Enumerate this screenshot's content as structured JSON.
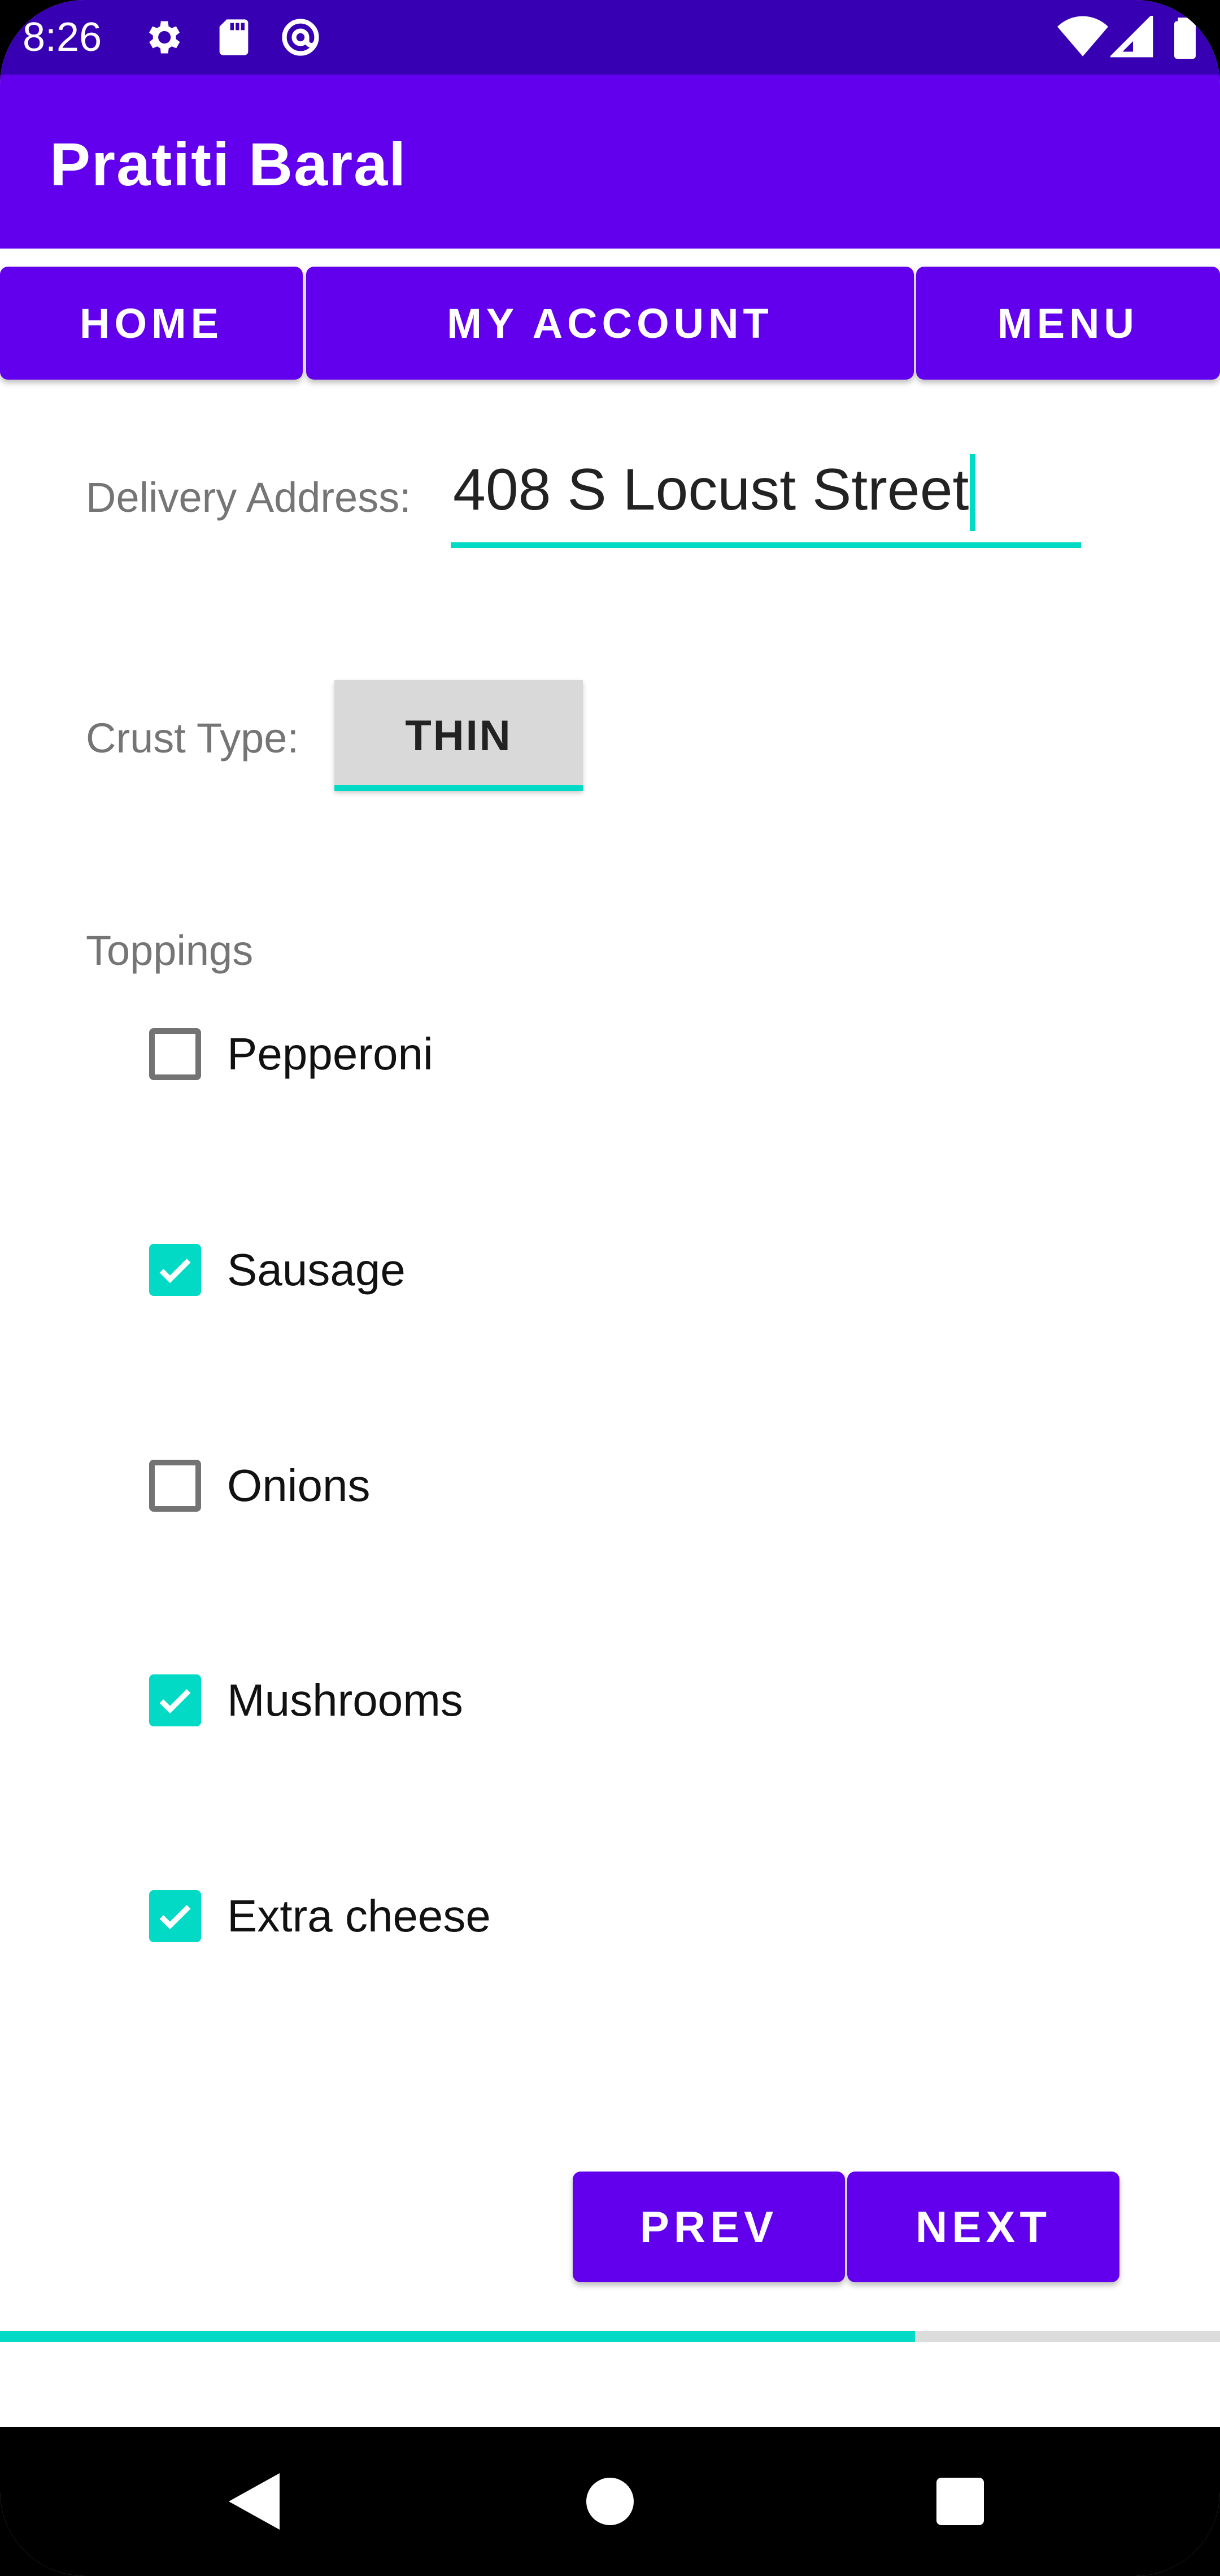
{
  "status_bar": {
    "time": "8:26",
    "icons": [
      "gear-icon",
      "sd-card-icon",
      "at-sign-icon",
      "wifi-icon",
      "cell-signal-icon",
      "battery-icon"
    ]
  },
  "app_bar": {
    "title": "Pratiti Baral"
  },
  "nav": {
    "home": "HOME",
    "my_account": "MY ACCOUNT",
    "menu": "MENU"
  },
  "form": {
    "address_label": "Delivery Address:",
    "address_value": "408 S Locust Street",
    "crust_label": "Crust Type:",
    "crust_value": "THIN",
    "toppings_label": "Toppings",
    "toppings": [
      {
        "label": "Pepperoni",
        "checked": false
      },
      {
        "label": "Sausage",
        "checked": true
      },
      {
        "label": "Onions",
        "checked": false
      },
      {
        "label": "Mushrooms",
        "checked": true
      },
      {
        "label": "Extra cheese",
        "checked": true
      }
    ]
  },
  "actions": {
    "prev": "PREV",
    "next": "NEXT"
  },
  "progress": {
    "fraction": 0.75
  },
  "colors": {
    "status_bar": "#3700b3",
    "primary": "#6200ee",
    "accent": "#03dac5"
  },
  "system_nav": {
    "icons": [
      "back-icon",
      "home-circle-icon",
      "recents-square-icon"
    ]
  }
}
